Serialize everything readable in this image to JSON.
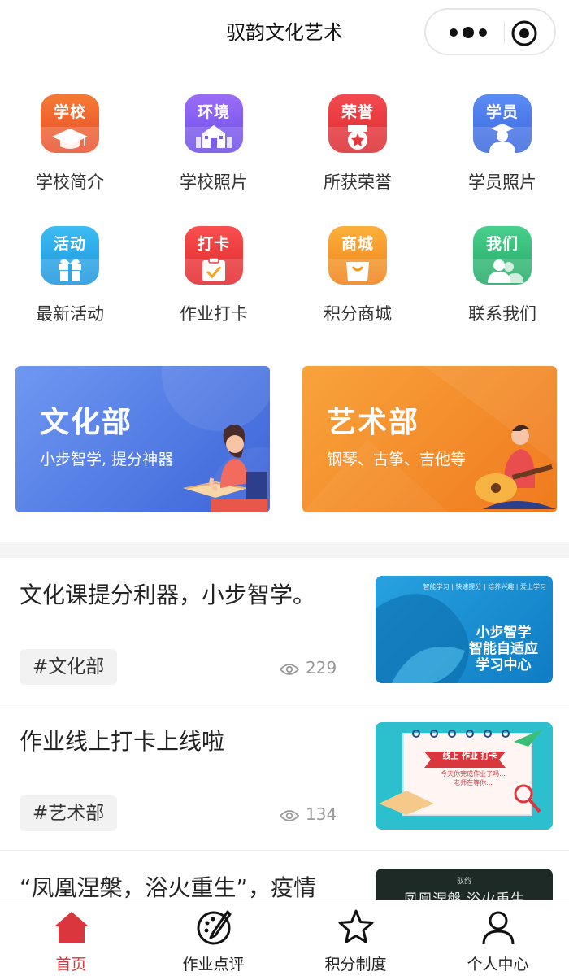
{
  "header": {
    "title": "驭韵文化艺术"
  },
  "colors": {
    "accent": "#d9363e",
    "tile_school": "#f0622d",
    "tile_env": "#7b5cf0",
    "tile_honor": "#e8373d",
    "tile_student": "#4a7de8",
    "tile_activity": "#29a8e8",
    "tile_checkin": "#f0383a",
    "tile_mall": "#f59a1f",
    "tile_contact": "#34c07a",
    "banner_culture": "#4f79e0",
    "banner_art": "#f58a24"
  },
  "grid": [
    {
      "tile_text": "学校",
      "label": "学校简介",
      "icon": "graduation-cap-icon"
    },
    {
      "tile_text": "环境",
      "label": "学校照片",
      "icon": "building-icon"
    },
    {
      "tile_text": "荣誉",
      "label": "所获荣誉",
      "icon": "medal-icon"
    },
    {
      "tile_text": "学员",
      "label": "学员照片",
      "icon": "student-icon"
    },
    {
      "tile_text": "活动",
      "label": "最新活动",
      "icon": "gift-icon"
    },
    {
      "tile_text": "打卡",
      "label": "作业打卡",
      "icon": "clipboard-check-icon"
    },
    {
      "tile_text": "商城",
      "label": "积分商城",
      "icon": "shopping-bag-icon"
    },
    {
      "tile_text": "我们",
      "label": "联系我们",
      "icon": "people-icon"
    }
  ],
  "banners": [
    {
      "title": "文化部",
      "subtitle": "小步智学, 提分神器"
    },
    {
      "title": "艺术部",
      "subtitle": "钢琴、古筝、吉他等"
    }
  ],
  "articles": [
    {
      "title": "文化课提分利器，小步智学。",
      "tag": "#文化部",
      "views": "229",
      "thumb": {
        "top": "智能学习 | 快速提分 | 培养兴趣 | 爱上学习",
        "lines": [
          "小步智学",
          "智能自适应",
          "学习中心"
        ]
      }
    },
    {
      "title": "作业线上打卡上线啦",
      "tag": "#艺术部",
      "views": "134",
      "thumb": {
        "ribbon": "线上 作业 打卡",
        "lines": [
          "今天你完成作业了吗...",
          "老师在等你..."
        ]
      }
    },
    {
      "title": "“凤凰涅槃，浴火重生”，疫情",
      "thumb": {
        "top": "驭韵",
        "lines": [
          "凤凰涅槃 浴火重生"
        ]
      }
    }
  ],
  "tabbar": [
    {
      "label": "首页",
      "icon": "home-icon",
      "active": true
    },
    {
      "label": "作业点评",
      "icon": "palette-icon",
      "active": false
    },
    {
      "label": "积分制度",
      "icon": "star-icon",
      "active": false
    },
    {
      "label": "个人中心",
      "icon": "person-icon",
      "active": false
    }
  ]
}
